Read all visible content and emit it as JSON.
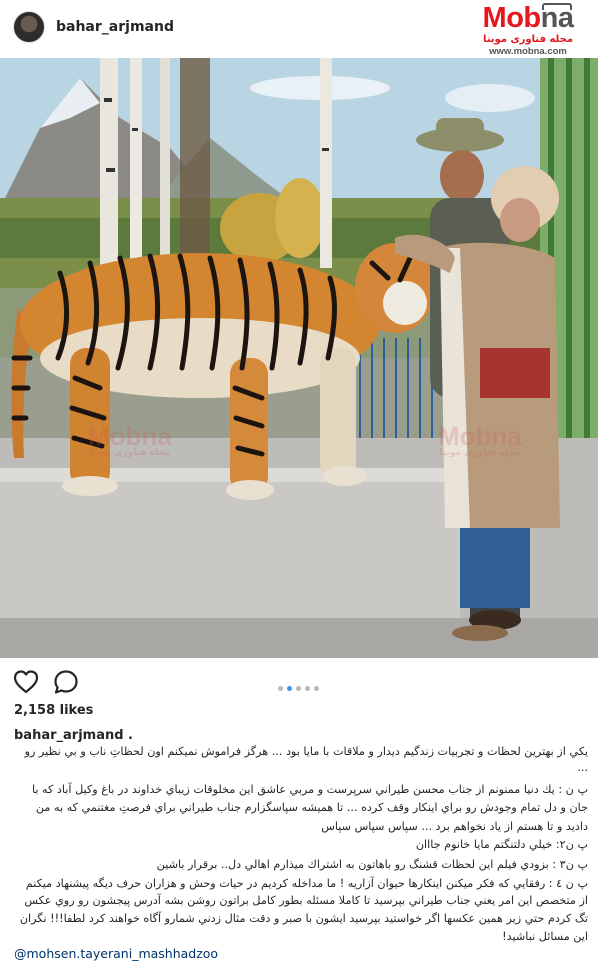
{
  "post": {
    "username": "bahar_arjmand",
    "likes": "2,158 likes",
    "caption_username": "bahar_arjmand .",
    "carousel": {
      "count": 5,
      "active_index": 1
    },
    "caption_lines": [
      "يكي از بهترين لحظات و تجربيات زندگيم ديدار و ملاقات با مايا بود ... هرگز فراموش نميكنم اون لحظاتِ ناب و بي نظير رو",
      "...",
      "پ ن : يك دنيا ممنونم از جناب محسن طيراني سرپرست و مربي عاشق اين مخلوقات زيباي خداوند در باغ وكيل آباد كه با",
      "جان و دل تمام وجودش رو براي اينكار وقف كرده ... تا هميشه سپاسگزارم جناب طيراني براي فرصتِ مغتنمي كه به من",
      "داديد و تا هستم از ياد نخواهم برد ... سپاس سپاس سپاس",
      "پ ن٢: خيلي دلتنگتم مايا خانوم جااان",
      "پ ن٣ : بزودي فيلم اين لحظات قشنگ رو باهاتون به اشتراك ميذارم اهالي دل.. برقرار باشين",
      "پ ن ٤ : رفقايي كه فكر ميكنن اينكارها حيوان آزاريه ! ما مداخله كرديم در حيات وحش و هزاران حرف ديگه پيشنهاد ميكنم",
      "از متخصص اين امر يعني جناب طيراني بپرسيد تا كاملا مسئله بطور كامل براتون روشن بشه آدرس پيجشون رو روي عكس",
      "تگ كردم حتي زير همين عكسها اگر خواستيد بپرسيد ايشون با صبر و دقت مثال زدني شمارو آگاه خواهند كرد لطفا!!! نگران",
      "اين مسائل نباشيد!"
    ],
    "mention": "@mohsen.tayerani_mashhadzoo"
  },
  "watermark": {
    "brand_left": "Mob",
    "brand_right": "na",
    "tagline": "مجله فناوری موبنا",
    "url": "www.mobna.com",
    "photo_mark": "Mobna",
    "photo_tagline": "مجله فناوری موبنا"
  },
  "icons": {
    "like": "heart-outline-icon",
    "comment": "comment-bubble-icon"
  },
  "colors": {
    "mention": "#003569",
    "carousel_active": "#3897f0",
    "watermark_red": "#e5171f"
  }
}
